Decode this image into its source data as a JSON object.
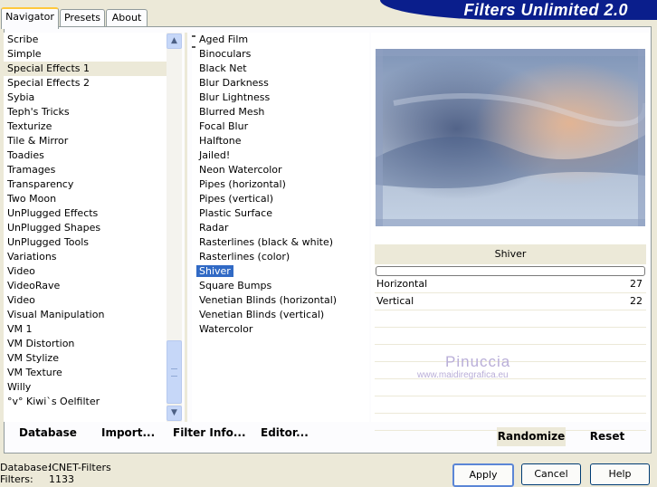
{
  "tabs": [
    {
      "label": "Navigator"
    },
    {
      "label": "Presets"
    },
    {
      "label": "About"
    }
  ],
  "header": {
    "title": "Filters Unlimited 2.0"
  },
  "categories": [
    "Scribe",
    "Simple",
    "Special Effects 1",
    "Special Effects 2",
    "Sybia",
    "Teph's Tricks",
    "Texturize",
    "Tile & Mirror",
    "Toadies",
    "Tramages",
    "Transparency",
    "Two Moon",
    "UnPlugged Effects",
    "UnPlugged Shapes",
    "UnPlugged Tools",
    "Variations",
    "Video",
    "VideoRave",
    "Video",
    "Visual Manipulation",
    "VM 1",
    "VM Distortion",
    "VM Stylize",
    "VM Texture",
    "Willy",
    "°v° Kiwi`s Oelfilter"
  ],
  "selected_category": "Special Effects 1",
  "filters": [
    "Aged Film",
    "Binoculars",
    "Black Net",
    "Blur Darkness",
    "Blur Lightness",
    "Blurred Mesh",
    "Focal Blur",
    "Halftone",
    "Jailed!",
    "Neon Watercolor",
    "Pipes (horizontal)",
    "Pipes (vertical)",
    "Plastic Surface",
    "Radar",
    "Rasterlines (black & white)",
    "Rasterlines (color)",
    "Shiver",
    "Square Bumps",
    "Venetian Blinds (horizontal)",
    "Venetian Blinds (vertical)",
    "Watercolor"
  ],
  "selected_filter": "Shiver",
  "bottom_buttons": {
    "database": "Database",
    "import": "Import...",
    "filter_info": "Filter Info...",
    "editor": "Editor..."
  },
  "param_panel": {
    "filter_name": "Shiver",
    "progress": 0,
    "params": [
      {
        "label": "Horizontal",
        "value": "27"
      },
      {
        "label": "Vertical",
        "value": "22"
      }
    ]
  },
  "watermark": {
    "name": "Pinuccia",
    "url": "www.maidiregrafica.eu"
  },
  "preset_buttons": {
    "randomize": "Randomize",
    "reset": "Reset"
  },
  "status": {
    "database_label": "Database:",
    "database_value": "ICNET-Filters",
    "filters_label": "Filters:",
    "filters_value": "1133"
  },
  "dialog_buttons": {
    "apply": "Apply",
    "cancel": "Cancel",
    "help": "Help"
  }
}
